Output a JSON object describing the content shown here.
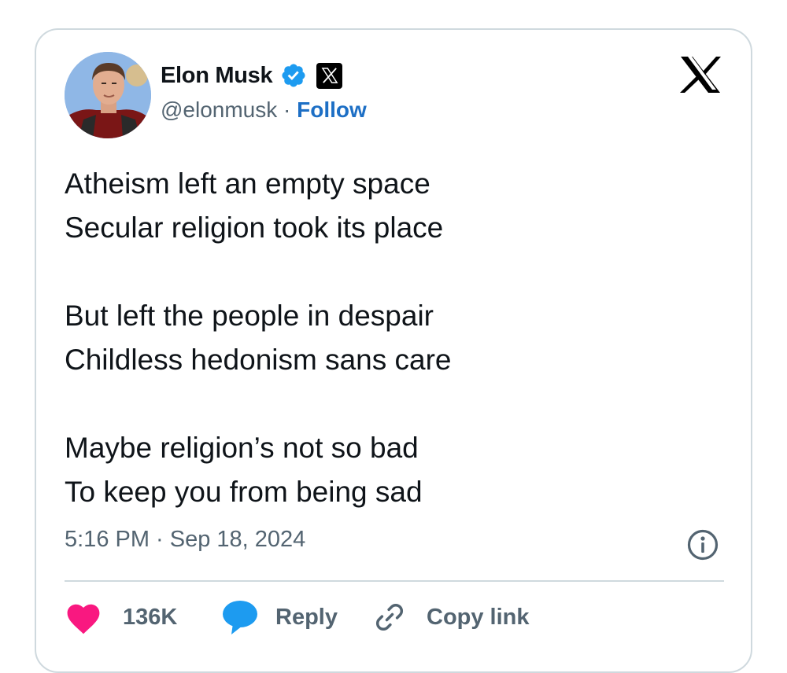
{
  "tweet": {
    "author": {
      "name": "Elon Musk",
      "handle": "@elonmusk",
      "separator": " · ",
      "follow_label": "Follow",
      "verified_badge_icon": "verified-check-icon",
      "affiliation_icon": "x-logo-icon"
    },
    "platform_logo_icon": "x-logo-icon",
    "lines": [
      "Atheism left an empty space",
      "Secular religion took its place",
      "",
      "But left the people in despair",
      "Childless hedonism sans care",
      "",
      "Maybe religion’s not so bad",
      "To keep you from being sad"
    ],
    "timestamp": "5:16 PM · Sep 18, 2024",
    "info_icon": "info-icon"
  },
  "actions": {
    "like_count": "136K",
    "reply_label": "Reply",
    "copy_label": "Copy link"
  },
  "colors": {
    "like": "#f91880",
    "reply": "#1d9bf0",
    "verified": "#1d9bf0",
    "follow": "#1d6fc5",
    "secondary_text": "#536471",
    "border": "#cfd9de"
  }
}
